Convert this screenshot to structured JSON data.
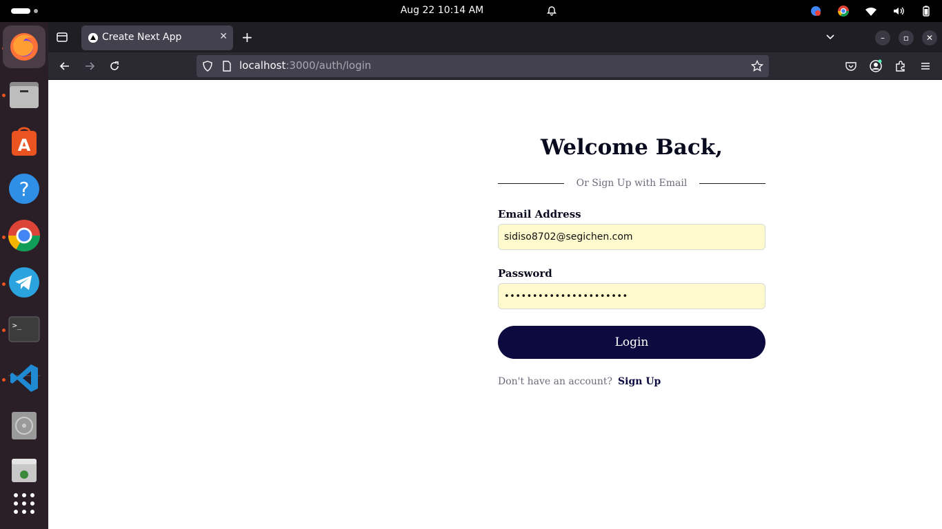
{
  "system": {
    "clock": "Aug 22  10:14 AM"
  },
  "browser": {
    "tab_title": "Create Next App",
    "tab_close": "✕",
    "new_tab": "+",
    "url_host": "localhost",
    "url_path": ":3000/auth/login"
  },
  "page": {
    "heading": "Welcome Back,",
    "divider_text": "Or Sign Up with Email",
    "email_label": "Email Address",
    "email_value": "sidiso8702@segichen.com",
    "password_label": "Password",
    "password_value": "••••••••••••••••••••••",
    "login_button": "Login",
    "no_account_text": "Don't have an account?",
    "signup_link": "Sign Up"
  },
  "colors": {
    "accent": "#0c0a3e",
    "input_autofill": "#fffacd"
  },
  "dock": {
    "items": [
      "firefox-icon",
      "files-icon",
      "app-center-icon",
      "help-icon",
      "chrome-icon",
      "telegram-icon",
      "terminal-icon",
      "vscode-icon",
      "disc-icon",
      "trash-icon",
      "app-grid-icon"
    ]
  }
}
